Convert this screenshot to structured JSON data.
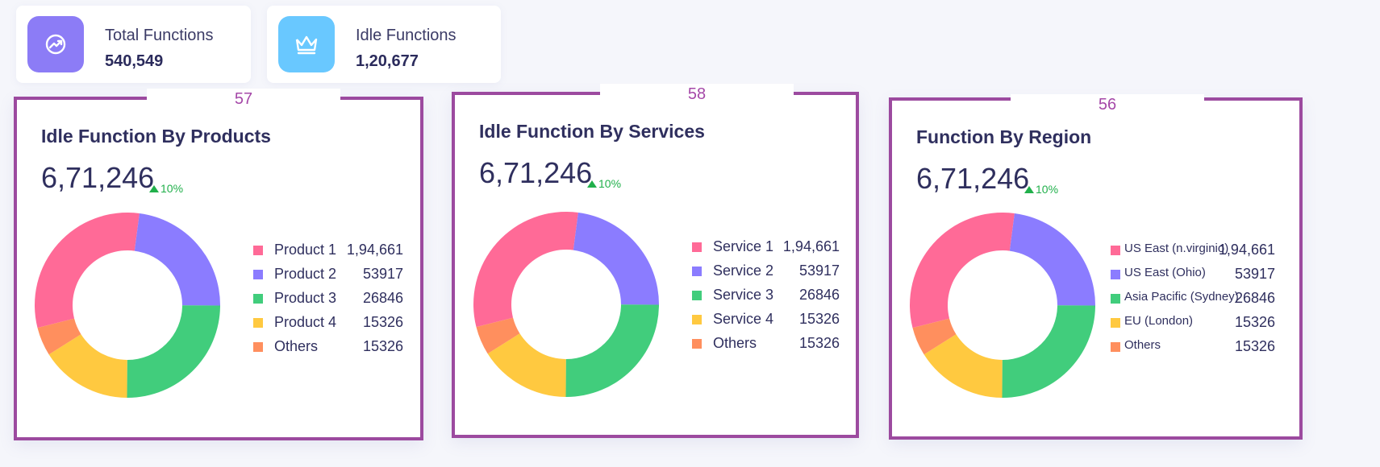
{
  "stats": [
    {
      "label": "Total Functions",
      "value": "540,549",
      "icon": "trending-icon",
      "color": "#8c7cf6"
    },
    {
      "label": "Idle Functions",
      "value": "1,20,677",
      "icon": "crown-icon",
      "color": "#69c8ff"
    }
  ],
  "panels": [
    {
      "tab": "57",
      "title": "Idle Function By Products",
      "total": "6,71,246",
      "trend": "10%",
      "legend": [
        {
          "label": "Product 1",
          "value": "1,94,661",
          "color": "#ff6a97"
        },
        {
          "label": "Product 2",
          "value": "53917",
          "color": "#8b7cff"
        },
        {
          "label": "Product 3",
          "value": "26846",
          "color": "#41cd7c"
        },
        {
          "label": "Product 4",
          "value": "15326",
          "color": "#ffc940"
        },
        {
          "label": "Others",
          "value": "15326",
          "color": "#ff8f5e"
        }
      ]
    },
    {
      "tab": "58",
      "title": "Idle Function By Services",
      "total": "6,71,246",
      "trend": "10%",
      "legend": [
        {
          "label": "Service 1",
          "value": "1,94,661",
          "color": "#ff6a97"
        },
        {
          "label": "Service 2",
          "value": "53917",
          "color": "#8b7cff"
        },
        {
          "label": "Service 3",
          "value": "26846",
          "color": "#41cd7c"
        },
        {
          "label": "Service 4",
          "value": "15326",
          "color": "#ffc940"
        },
        {
          "label": "Others",
          "value": "15326",
          "color": "#ff8f5e"
        }
      ]
    },
    {
      "tab": "56",
      "title": "Function By Region",
      "total": "6,71,246",
      "trend": "10%",
      "legend": [
        {
          "label": "US East (n.virginio)",
          "value": "1,94,661",
          "color": "#ff6a97"
        },
        {
          "label": "US East (Ohio)",
          "value": "53917",
          "color": "#8b7cff"
        },
        {
          "label": "Asia Pacific (Sydney)",
          "value": "26846",
          "color": "#41cd7c"
        },
        {
          "label": "EU (London)",
          "value": "15326",
          "color": "#ffc940"
        },
        {
          "label": "Others",
          "value": "15326",
          "color": "#ff8f5e"
        }
      ]
    }
  ],
  "chart_data": [
    {
      "type": "pie",
      "categories": [
        "Product 1",
        "Product 2",
        "Product 3",
        "Product 4",
        "Others"
      ],
      "values": [
        31,
        23,
        25,
        16,
        5
      ]
    },
    {
      "type": "pie",
      "categories": [
        "Service 1",
        "Service 2",
        "Service 3",
        "Service 4",
        "Others"
      ],
      "values": [
        31,
        23,
        25,
        16,
        5
      ]
    },
    {
      "type": "pie",
      "categories": [
        "US East (n.virginio)",
        "US East (Ohio)",
        "Asia Pacific (Sydney)",
        "EU (London)",
        "Others"
      ],
      "values": [
        31,
        23,
        25,
        16,
        5
      ]
    }
  ]
}
